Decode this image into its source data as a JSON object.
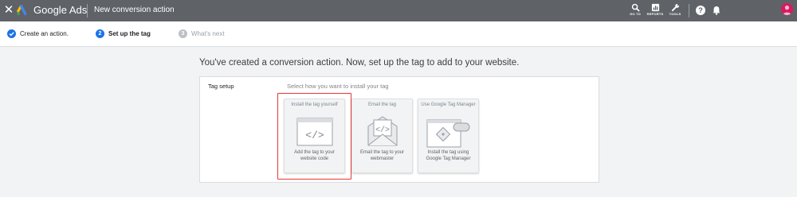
{
  "header": {
    "brand": "Google Ads",
    "title": "New conversion action",
    "tools": [
      {
        "icon": "search-icon",
        "label": "GO TO"
      },
      {
        "icon": "reports-icon",
        "label": "REPORTS"
      },
      {
        "icon": "wrench-icon",
        "label": "TOOLS"
      }
    ],
    "colors": {
      "bar": "#5f6368",
      "avatar": "#d81b60"
    }
  },
  "stepper": {
    "steps": [
      {
        "badge": "",
        "label": "Create an action.",
        "state": "done"
      },
      {
        "badge": "2",
        "label": "Set up the tag",
        "state": "current"
      },
      {
        "badge": "3",
        "label": "What's next",
        "state": "upcoming"
      }
    ],
    "colors": {
      "active": "#1a73e8",
      "inactive": "#9aa0a6"
    }
  },
  "main": {
    "headline": "You've created a conversion action. Now, set up the tag to add to your website.",
    "section_label": "Tag setup",
    "instruction": "Select how you want to install your tag",
    "options": [
      {
        "title": "Install the tag yourself",
        "description": "Add the tag to your website code",
        "icon": "code-window-icon"
      },
      {
        "title": "Email the tag",
        "description": "Email the tag to your webmaster",
        "icon": "envelope-code-icon"
      },
      {
        "title": "Use Google Tag Manager",
        "description": "Install the tag using Google Tag Manager",
        "icon": "tag-manager-icon"
      }
    ],
    "highlight_color": "#e53935"
  }
}
